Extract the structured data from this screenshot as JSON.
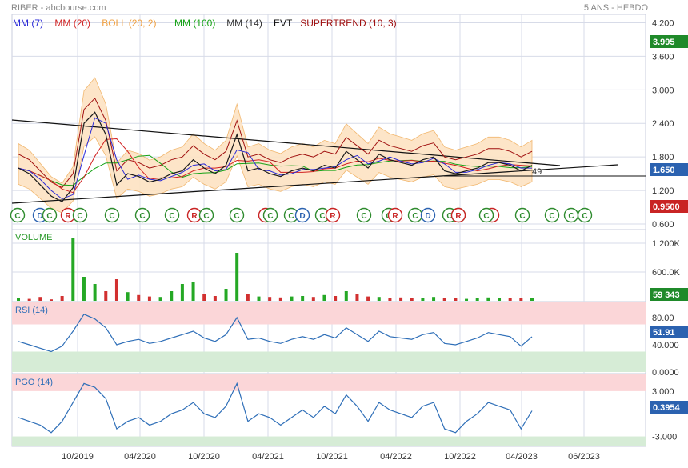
{
  "header": {
    "left_title": "RIBER - abcbourse.com",
    "right_title": "5 ANS - HEBDO"
  },
  "colors": {
    "grid": "#d7dbe8",
    "frame": "#c9cede",
    "text_muted": "#666666",
    "price": "#1a1a1a",
    "mm7": "#2a2ad8",
    "mm20": "#d12020",
    "mm100": "#16a316",
    "mm14": "#333333",
    "boll_fill": "#fde3c3",
    "boll_line": "#f0b060",
    "supertrend": "#a01010",
    "trendline": "#111111",
    "volume_up": "#25a825",
    "volume_down": "#d23030",
    "rsi_line": "#2f6fb8",
    "zone_high": "#fbd6d8",
    "zone_low": "#d6ecd6",
    "badge_green": "#2e8b2e",
    "badge_red": "#c92424",
    "badge_blue": "#2b62b0"
  },
  "legend": [
    {
      "label": "MM (7)",
      "color": "#2a2ad8"
    },
    {
      "label": "MM (20)",
      "color": "#d12020"
    },
    {
      "label": "BOLL (20, 2)",
      "color": "#f0a040"
    },
    {
      "label": "MM (100)",
      "color": "#16a316"
    },
    {
      "label": "MM (14)",
      "color": "#333333"
    },
    {
      "label": "EVT",
      "color": "#111111"
    },
    {
      "label": "SUPERTREND (10, 3)",
      "color": "#a01010"
    }
  ],
  "chart_data": [
    {
      "type": "line",
      "panel": "price",
      "yticks": [
        "4.200",
        "3.600",
        "3.000",
        "2.400",
        "1.800",
        "1.200",
        "0.600"
      ],
      "ylim": [
        0.5,
        4.35
      ],
      "xticks": [
        "10/2019",
        "04/2020",
        "10/2020",
        "04/2021",
        "10/2021",
        "04/2022",
        "10/2022",
        "04/2023",
        "06/2023"
      ],
      "series": [
        {
          "name": "RIBER",
          "x": [
            "2019-06",
            "2019-07",
            "2019-08",
            "2019-09",
            "2019-10",
            "2019-11",
            "2019-12",
            "2020-01",
            "2020-02",
            "2020-03",
            "2020-04",
            "2020-05",
            "2020-06",
            "2020-07",
            "2020-08",
            "2020-09",
            "2020-10",
            "2020-11",
            "2020-12",
            "2021-01",
            "2021-02",
            "2021-03",
            "2021-04",
            "2021-05",
            "2021-06",
            "2021-07",
            "2021-08",
            "2021-09",
            "2021-10",
            "2021-11",
            "2021-12",
            "2022-01",
            "2022-02",
            "2022-03",
            "2022-04",
            "2022-05",
            "2022-06",
            "2022-07",
            "2022-08",
            "2022-09",
            "2022-10",
            "2022-11",
            "2022-12",
            "2023-01",
            "2023-02",
            "2023-03",
            "2023-04",
            "2023-05"
          ],
          "values": [
            1.6,
            1.5,
            1.3,
            1.1,
            1.0,
            1.25,
            2.4,
            2.6,
            2.2,
            1.3,
            1.5,
            1.45,
            1.35,
            1.4,
            1.5,
            1.55,
            1.75,
            1.6,
            1.5,
            1.65,
            2.2,
            1.55,
            1.6,
            1.5,
            1.45,
            1.55,
            1.6,
            1.55,
            1.65,
            1.6,
            1.9,
            1.75,
            1.6,
            1.85,
            1.75,
            1.7,
            1.65,
            1.75,
            1.8,
            1.55,
            1.5,
            1.55,
            1.6,
            1.7,
            1.7,
            1.65,
            1.55,
            1.65
          ]
        }
      ],
      "last_price": "1.650",
      "price_labels": [
        "3.995",
        "0.9500"
      ],
      "trend_annotation": "49",
      "signal_badges": [
        "C",
        "D",
        "C",
        "R",
        "C",
        "C",
        "C",
        "C",
        "R",
        "C",
        "C",
        "R",
        "C",
        "C",
        "D",
        "C",
        "R",
        "C",
        "C",
        "R",
        "C",
        "D",
        "C",
        "C",
        "R",
        "C",
        "C",
        "C",
        "C",
        "R",
        "C"
      ]
    },
    {
      "type": "bar",
      "panel": "volume",
      "title": "VOLUME",
      "yticks": [
        "1 200K",
        "600.0K"
      ],
      "ylim": [
        0,
        1400000
      ],
      "last_label": "59 343",
      "series": [
        {
          "name": "VOLUME",
          "values": [
            60000,
            40000,
            80000,
            30000,
            100000,
            1300000,
            500000,
            350000,
            200000,
            450000,
            180000,
            120000,
            90000,
            80000,
            200000,
            350000,
            400000,
            150000,
            100000,
            250000,
            1000000,
            150000,
            90000,
            80000,
            70000,
            90000,
            100000,
            80000,
            120000,
            100000,
            200000,
            150000,
            90000,
            80000,
            60000,
            70000,
            50000,
            60000,
            80000,
            60000,
            50000,
            40000,
            50000,
            70000,
            60000,
            50000,
            60000,
            59343
          ]
        }
      ]
    },
    {
      "type": "line",
      "panel": "rsi",
      "title": "RSI (14)",
      "yticks": [
        "80.00",
        "40.000",
        "0.0000"
      ],
      "ylim": [
        0,
        100
      ],
      "bands": [
        70,
        30
      ],
      "last_label": "51.91",
      "series": [
        {
          "name": "RSI (14)",
          "values": [
            45,
            40,
            35,
            30,
            38,
            60,
            85,
            78,
            65,
            40,
            45,
            48,
            42,
            45,
            50,
            55,
            60,
            50,
            45,
            55,
            80,
            48,
            50,
            45,
            42,
            48,
            52,
            48,
            55,
            50,
            65,
            55,
            45,
            60,
            52,
            50,
            48,
            55,
            58,
            42,
            40,
            45,
            50,
            58,
            55,
            52,
            38,
            51.91
          ]
        }
      ]
    },
    {
      "type": "line",
      "panel": "pgo",
      "title": "PGO (14)",
      "yticks": [
        "3.000",
        "-3.000"
      ],
      "ylim": [
        -4,
        5
      ],
      "bands": [
        3,
        -3
      ],
      "last_label": "0.3954",
      "series": [
        {
          "name": "PGO (14)",
          "values": [
            -0.5,
            -1,
            -1.5,
            -2.5,
            -1,
            1.5,
            4,
            3.5,
            2,
            -2,
            -1,
            -0.5,
            -1.5,
            -1,
            0,
            0.5,
            1.5,
            0,
            -0.5,
            1,
            4,
            -1,
            0,
            -0.5,
            -1.5,
            -0.5,
            0.5,
            -0.5,
            1,
            0,
            2.5,
            1,
            -1,
            1.5,
            0.5,
            0,
            -0.5,
            1,
            1.5,
            -2,
            -2.5,
            -1,
            0,
            1.5,
            1,
            0.5,
            -2,
            0.3954
          ]
        }
      ]
    }
  ]
}
